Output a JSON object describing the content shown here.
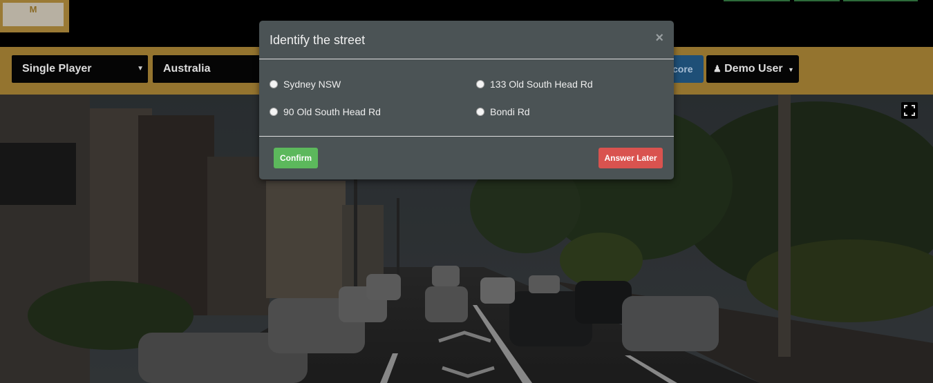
{
  "header": {
    "logo_text": "M"
  },
  "toolbar": {
    "mode_select": "Single Player",
    "region_select": "Australia",
    "score_button": "core",
    "user_button": "Demo User"
  },
  "modal": {
    "title": "Identify the street",
    "close_symbol": "×",
    "options": [
      {
        "label": "Sydney NSW"
      },
      {
        "label": "133 Old South Head Rd"
      },
      {
        "label": "90 Old South Head Rd"
      },
      {
        "label": "Bondi Rd"
      }
    ],
    "confirm_label": "Confirm",
    "later_label": "Answer Later"
  },
  "icons": {
    "person": "person-icon",
    "fullscreen": "fullscreen-icon",
    "caret": "caret-down-icon"
  },
  "colors": {
    "brand_gold": "#94742f",
    "confirm": "#5cb85c",
    "answer_later": "#d9534f",
    "modal_bg": "#4b5355"
  }
}
